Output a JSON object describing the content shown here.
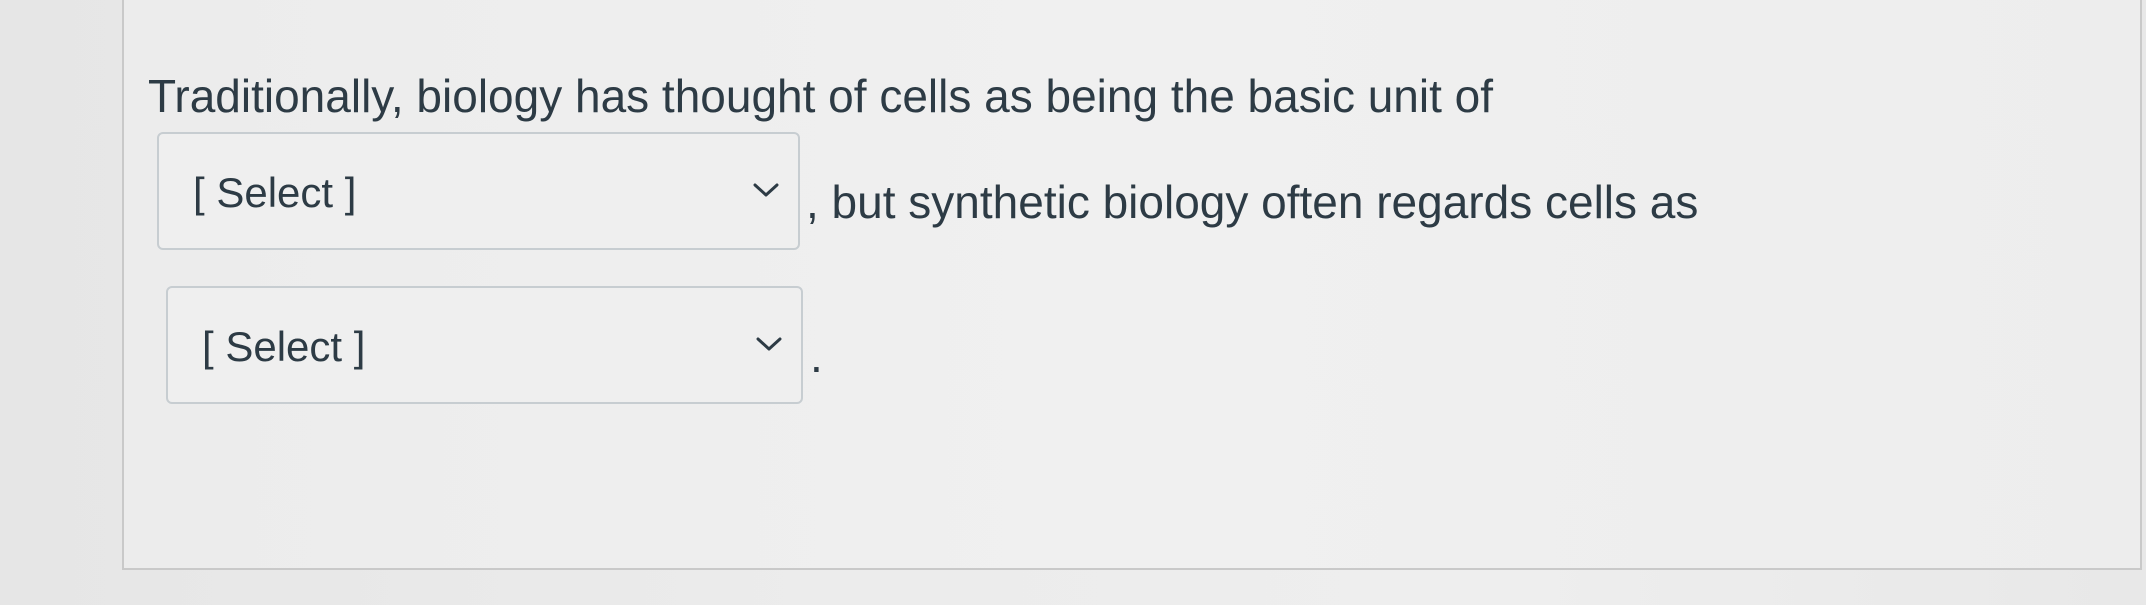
{
  "question": {
    "text_before": "Traditionally, biology has thought of cells as being the basic unit of",
    "text_middle": ", but synthetic biology often regards cells as",
    "text_end": "."
  },
  "dropdowns": [
    {
      "selected_label": "[ Select ]",
      "icon": "chevron-down-icon"
    },
    {
      "selected_label": "[ Select ]",
      "icon": "chevron-down-icon"
    }
  ],
  "colors": {
    "text": "#2d3b45",
    "select_border": "#c7cdd1",
    "card_border": "#c9c9c9"
  }
}
